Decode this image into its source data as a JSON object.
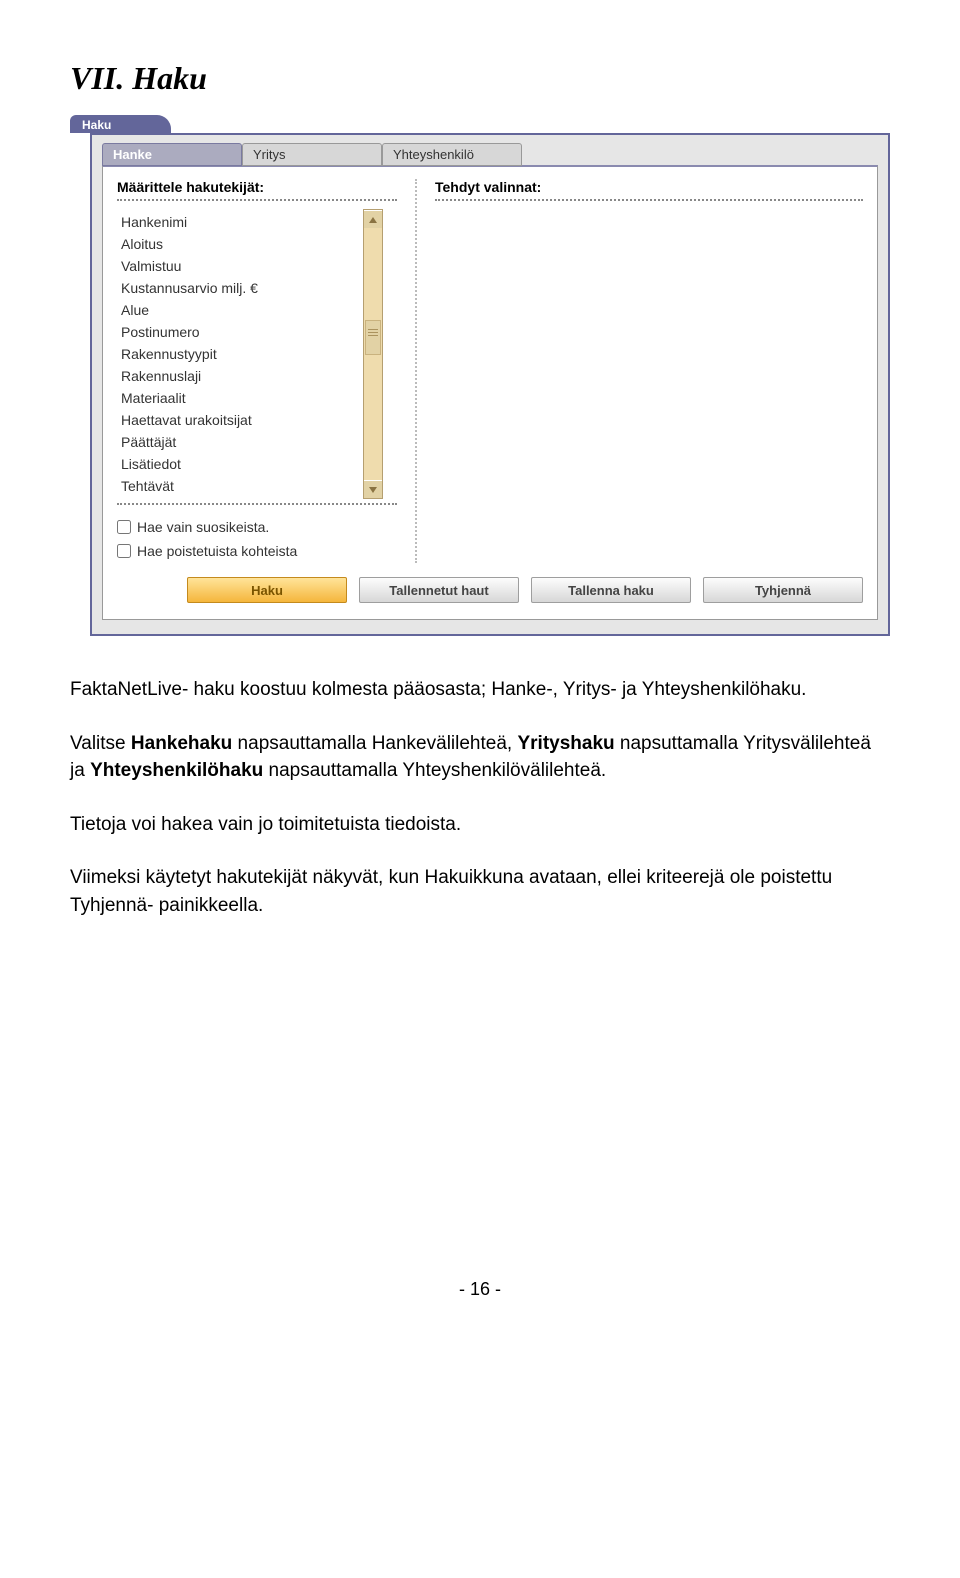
{
  "heading": "VII. Haku",
  "window": {
    "title_tab": "Haku",
    "tabs": [
      "Hanke",
      "Yritys",
      "Yhteyshenkilö"
    ],
    "active_tab_index": 0,
    "left_title": "Määrittele hakutekijät:",
    "right_title": "Tehdyt valinnat:",
    "facets": [
      "Hankenimi",
      "Aloitus",
      "Valmistuu",
      "Kustannusarvio milj. €",
      "Alue",
      "Postinumero",
      "Rakennustyypit",
      "Rakennuslaji",
      "Materiaalit",
      "Haettavat urakoitsijat",
      "Päättäjät",
      "Lisätiedot",
      "Tehtävät"
    ],
    "checks": {
      "favorites": "Hae vain suosikeista.",
      "removed": "Hae poistetuista kohteista"
    },
    "buttons": {
      "search": "Haku",
      "saved": "Tallennetut haut",
      "save": "Tallenna haku",
      "clear": "Tyhjennä"
    }
  },
  "body": {
    "p1": "FaktaNetLive- haku koostuu kolmesta pääosasta; Hanke-, Yritys- ja Yhteyshenkilöhaku.",
    "p2_pre": "Valitse ",
    "p2_b1": "Hankehaku",
    "p2_mid1": " napsauttamalla Hankevälilehteä, ",
    "p2_b2": "Yrityshaku",
    "p2_mid2": " napsuttamalla Yritysvälilehteä ja ",
    "p2_b3": "Yhteyshenkilöhaku",
    "p2_post": " napsauttamalla Yhteyshenkilövälilehteä.",
    "p3": "Tietoja voi hakea vain jo toimitetuista tiedoista.",
    "p4": "Viimeksi käytetyt hakutekijät näkyvät, kun Hakuikkuna avataan, ellei kriteerejä ole poistettu Tyhjennä- painikkeella."
  },
  "footer": "- 16 -"
}
